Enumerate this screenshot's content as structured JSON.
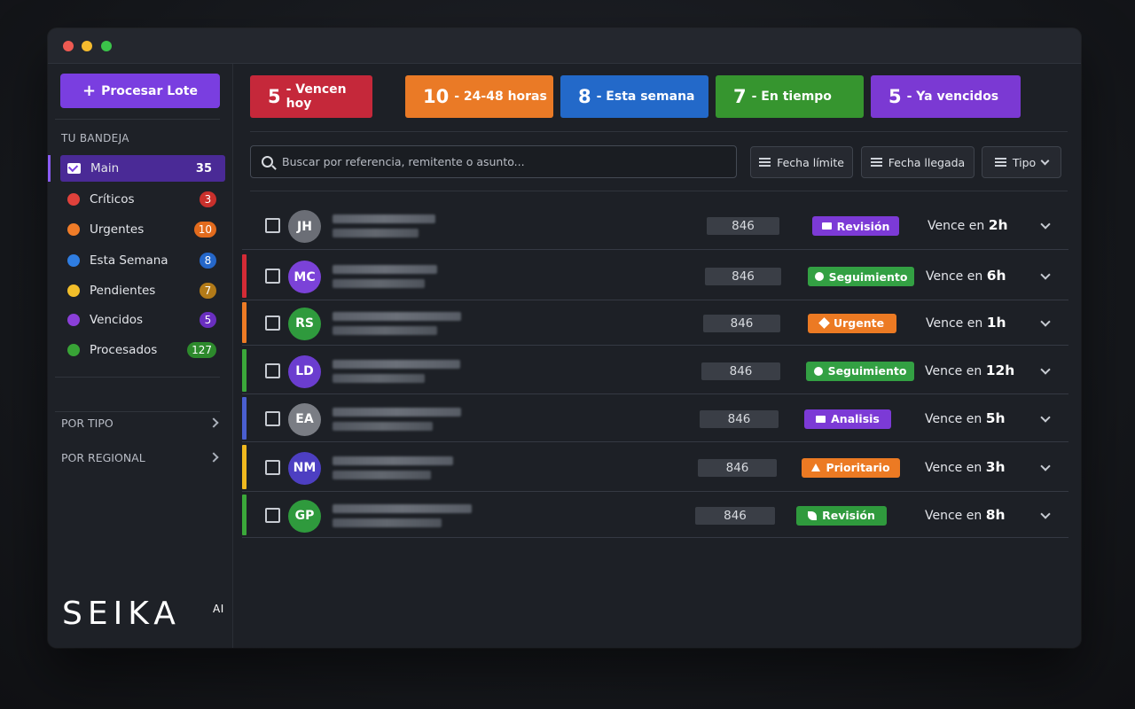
{
  "sidebar": {
    "process_button": "Procesar Lote",
    "inbox_label": "TU BANDEJA",
    "items": [
      {
        "label": "Main",
        "count": "35",
        "color": "#7a3ee0",
        "count_bg": "transparent"
      },
      {
        "label": "Críticos",
        "count": "3",
        "color": "#e0413b",
        "count_bg": "#c9302c"
      },
      {
        "label": "Urgentes",
        "count": "10",
        "color": "#f07c28",
        "count_bg": "#e26b1d"
      },
      {
        "label": "Esta Semana",
        "count": "8",
        "color": "#2f7de1",
        "count_bg": "#2567c9"
      },
      {
        "label": "Pendientes",
        "count": "7",
        "color": "#f2be2a",
        "count_bg": "#b27a18"
      },
      {
        "label": "Vencidos",
        "count": "5",
        "color": "#8a3fd8",
        "count_bg": "#6a2fc0"
      },
      {
        "label": "Procesados",
        "count": "127",
        "color": "#38a336",
        "count_bg": "#2d8a2c"
      }
    ],
    "by_type": "POR TIPO",
    "by_region": "POR REGIONAL",
    "logo": "SEIKA",
    "logo_sup": "AI"
  },
  "stats": [
    {
      "num": "5",
      "text": "- Vencen hoy",
      "color": "#c5283a"
    },
    {
      "num": "10",
      "text": "- 24-48 horas",
      "color": "#ea7a26"
    },
    {
      "num": "8",
      "text": "- Esta semana",
      "color": "#2369c9"
    },
    {
      "num": "7",
      "text": "- En tiempo",
      "color": "#36952f"
    },
    {
      "num": "5",
      "text": "- Ya vencidos",
      "color": "#7b39d3"
    }
  ],
  "search": {
    "placeholder": "Buscar por referencia, remitente o asunto..."
  },
  "filters": {
    "deadline": "Fecha límite",
    "arrival": "Fecha llegada",
    "type": "Tipo"
  },
  "rows": [
    {
      "initials": "JH",
      "avatar": "#6b6e76",
      "accent": "",
      "ref": "846",
      "tag": "Revisión",
      "tag_color": "#7c3ad6",
      "tag_icon": "mail",
      "due_prefix": "Vence en",
      "due_value": "2h"
    },
    {
      "initials": "MC",
      "avatar": "#7b42d8",
      "accent": "#d42b36",
      "ref": "846",
      "tag": "Seguimiento",
      "tag_color": "#33a043",
      "tag_icon": "circle",
      "due_prefix": "Vence en",
      "due_value": "6h"
    },
    {
      "initials": "RS",
      "avatar": "#2f9a3d",
      "accent": "#ee7b25",
      "ref": "846",
      "tag": "Urgente",
      "tag_color": "#ec7a23",
      "tag_icon": "diamond",
      "due_prefix": "Vence en",
      "due_value": "1h"
    },
    {
      "initials": "LD",
      "avatar": "#6b3dcf",
      "accent": "#3ba83a",
      "ref": "846",
      "tag": "Seguimiento",
      "tag_color": "#33a043",
      "tag_icon": "circle",
      "due_prefix": "Vence en",
      "due_value": "12h"
    },
    {
      "initials": "EA",
      "avatar": "#7a7d84",
      "accent": "#4a5fd0",
      "ref": "846",
      "tag": "Analisis",
      "tag_color": "#7c3ad6",
      "tag_icon": "mail",
      "due_prefix": "Vence en",
      "due_value": "5h"
    },
    {
      "initials": "NM",
      "avatar": "#4d3fc2",
      "accent": "#f0b91f",
      "ref": "846",
      "tag": "Prioritario",
      "tag_color": "#ec7a23",
      "tag_icon": "up",
      "due_prefix": "Vence en",
      "due_value": "3h"
    },
    {
      "initials": "GP",
      "avatar": "#2f9a3d",
      "accent": "#3ba83a",
      "ref": "846",
      "tag": "Revisión",
      "tag_color": "#2f9a3d",
      "tag_icon": "leaf",
      "due_prefix": "Vence en",
      "due_value": "8h"
    }
  ]
}
